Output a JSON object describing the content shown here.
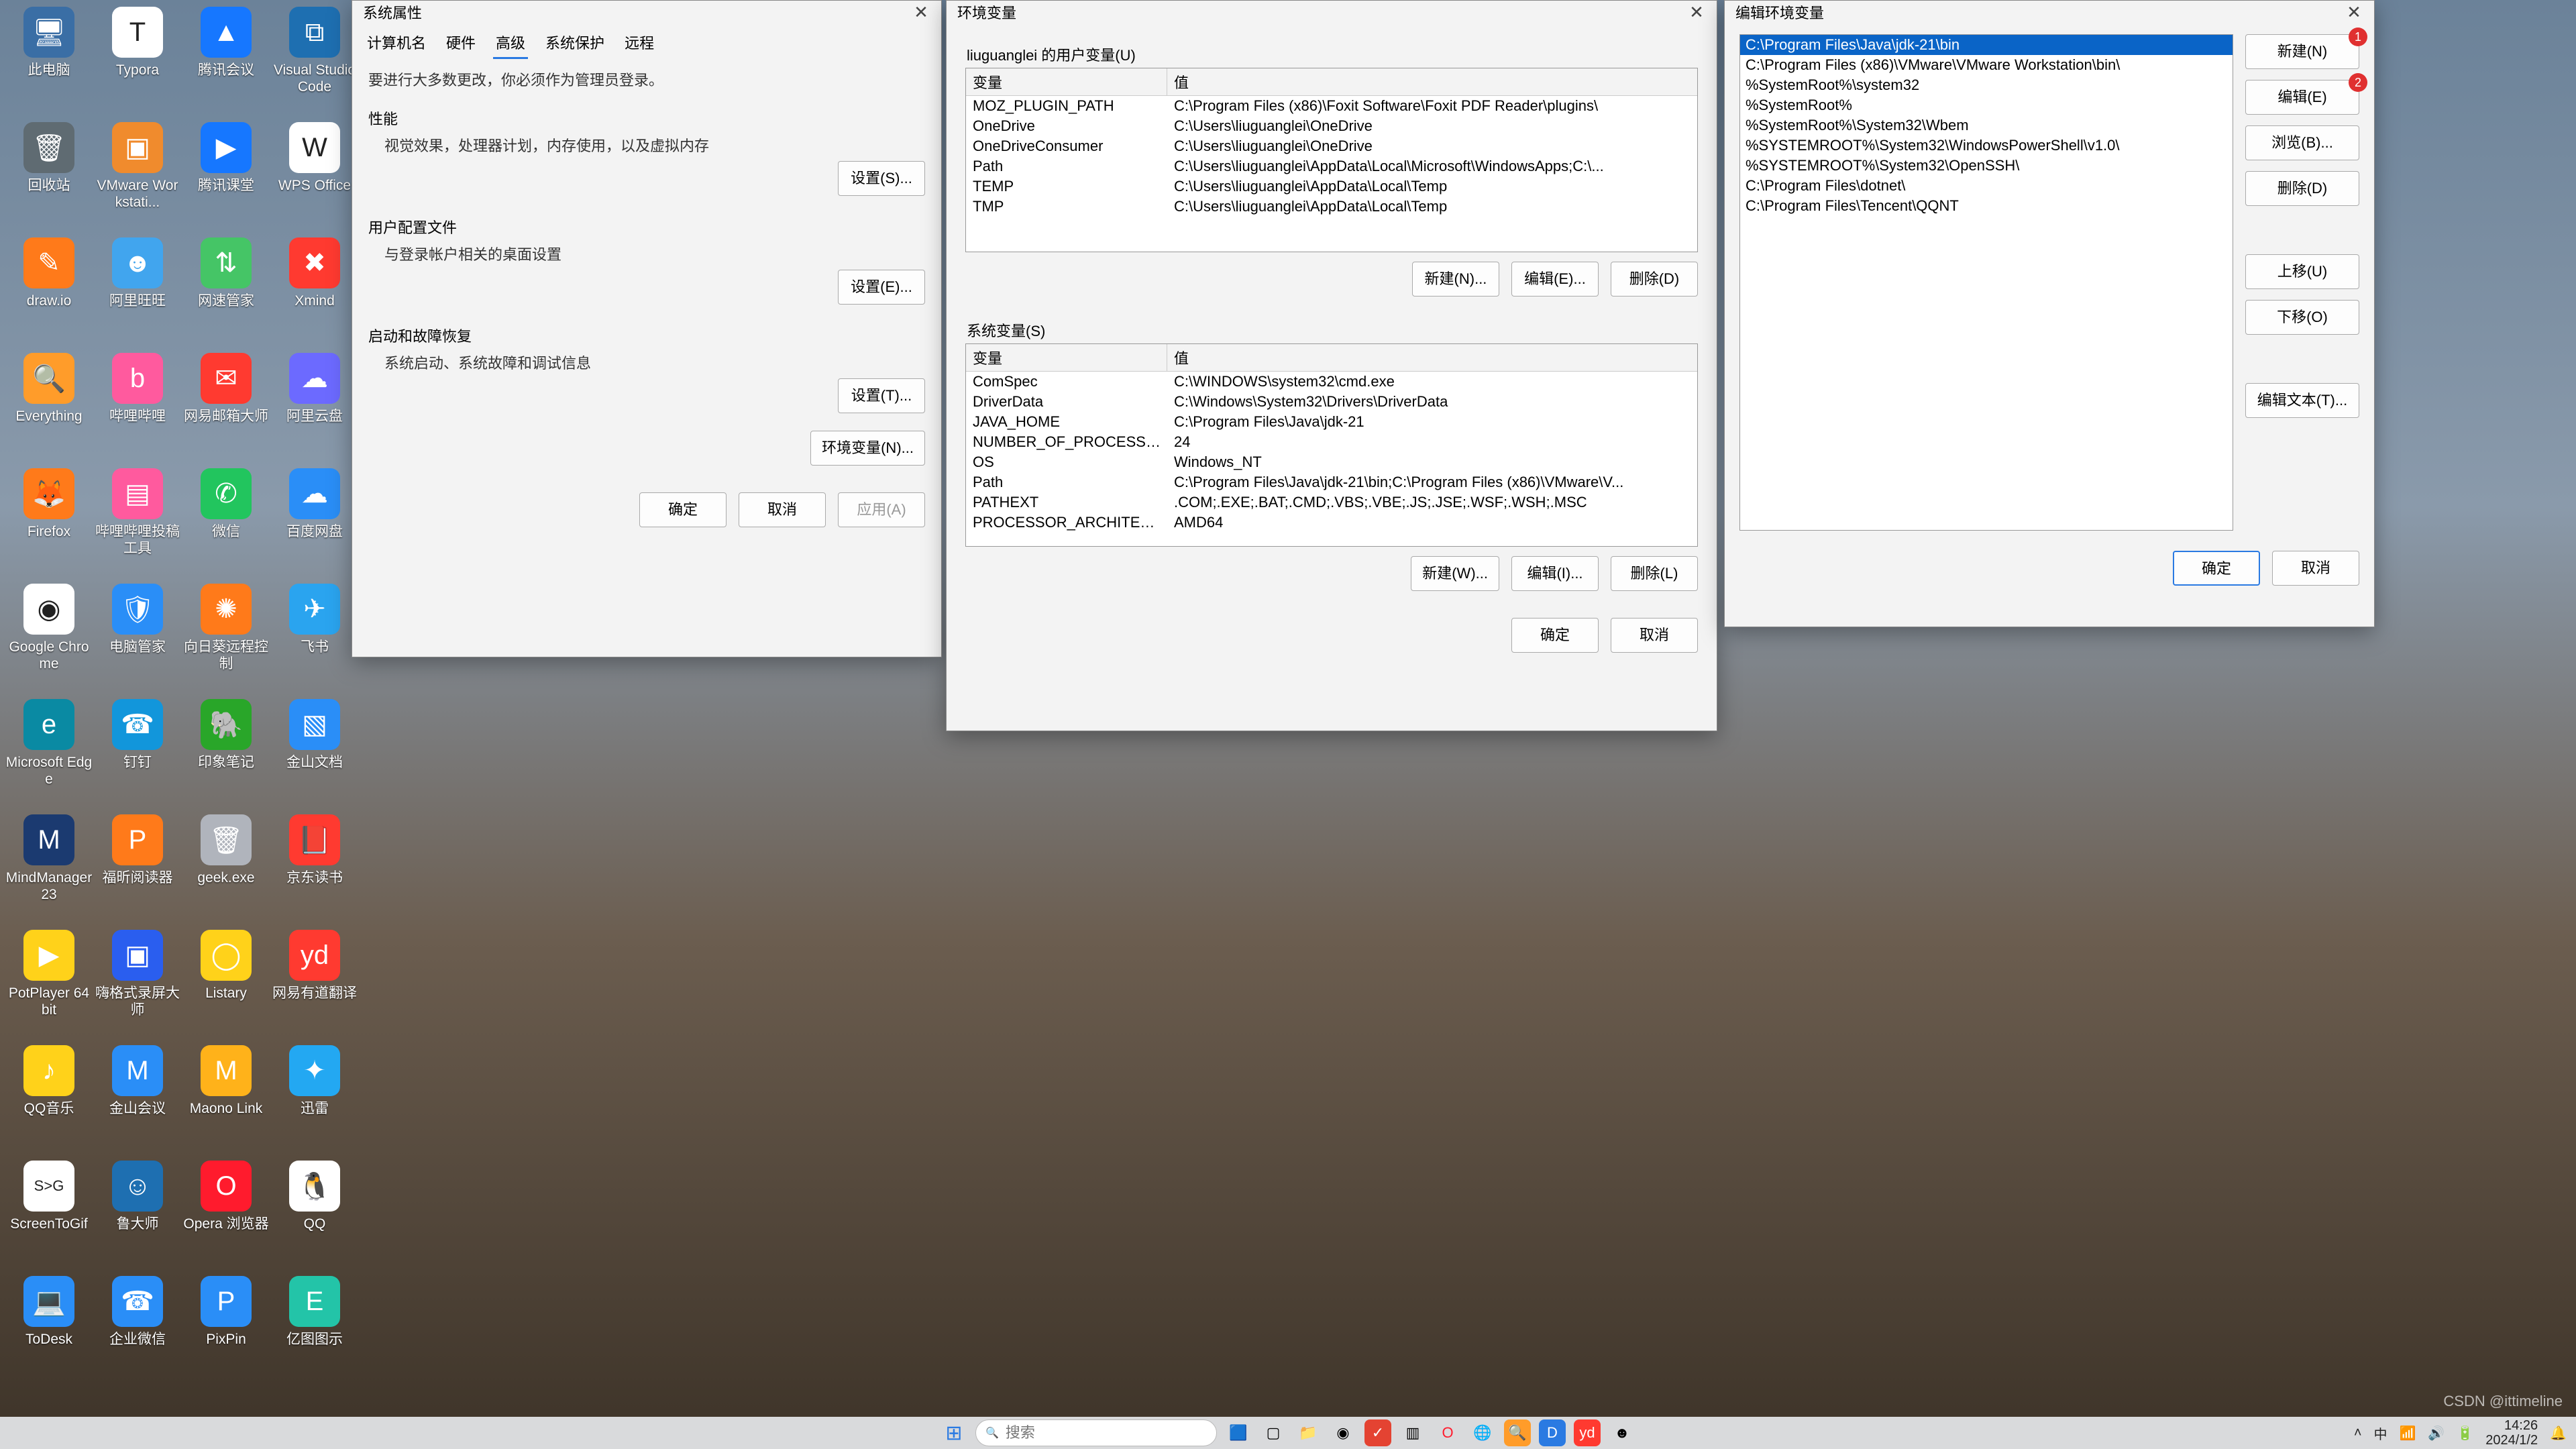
{
  "desktop_icons": [
    {
      "row": 0,
      "col": 0,
      "label": "此电脑",
      "bg": "#3a6ea5",
      "glyph": "🖥"
    },
    {
      "row": 0,
      "col": 1,
      "label": "Typora",
      "bg": "#ffffff",
      "glyph": "T"
    },
    {
      "row": 0,
      "col": 2,
      "label": "腾讯会议",
      "bg": "#1677ff",
      "glyph": "▲"
    },
    {
      "row": 0,
      "col": 3,
      "label": "Visual Studio Code",
      "bg": "#1e6fb1",
      "glyph": "⧉"
    },
    {
      "row": 1,
      "col": 0,
      "label": "回收站",
      "bg": "#5f6b72",
      "glyph": "🗑"
    },
    {
      "row": 1,
      "col": 1,
      "label": "VMware Workstati...",
      "bg": "#f08b2d",
      "glyph": "▣"
    },
    {
      "row": 1,
      "col": 2,
      "label": "腾讯课堂",
      "bg": "#1677ff",
      "glyph": "▶"
    },
    {
      "row": 1,
      "col": 3,
      "label": "WPS Office",
      "bg": "#ffffff",
      "glyph": "W"
    },
    {
      "row": 2,
      "col": 0,
      "label": "draw.io",
      "bg": "#ff7a1a",
      "glyph": "✎"
    },
    {
      "row": 2,
      "col": 1,
      "label": "阿里旺旺",
      "bg": "#41a5ee",
      "glyph": "☻"
    },
    {
      "row": 2,
      "col": 2,
      "label": "网速管家",
      "bg": "#45c566",
      "glyph": "⇅"
    },
    {
      "row": 2,
      "col": 3,
      "label": "Xmind",
      "bg": "#ff3a30",
      "glyph": "✖"
    },
    {
      "row": 3,
      "col": 0,
      "label": "Everything",
      "bg": "#ff9c2a",
      "glyph": "🔍"
    },
    {
      "row": 3,
      "col": 1,
      "label": "哔哩哔哩",
      "bg": "#ff5a9e",
      "glyph": "b"
    },
    {
      "row": 3,
      "col": 2,
      "label": "网易邮箱大师",
      "bg": "#ff3a30",
      "glyph": "✉"
    },
    {
      "row": 3,
      "col": 3,
      "label": "阿里云盘",
      "bg": "#6c6aff",
      "glyph": "☁"
    },
    {
      "row": 4,
      "col": 0,
      "label": "Firefox",
      "bg": "#ff7a1a",
      "glyph": "🦊"
    },
    {
      "row": 4,
      "col": 1,
      "label": "哔哩哔哩投稿工具",
      "bg": "#ff5a9e",
      "glyph": "▤"
    },
    {
      "row": 4,
      "col": 2,
      "label": "微信",
      "bg": "#22c55e",
      "glyph": "✆"
    },
    {
      "row": 4,
      "col": 3,
      "label": "百度网盘",
      "bg": "#2a8ef7",
      "glyph": "☁"
    },
    {
      "row": 5,
      "col": 0,
      "label": "Google Chrome",
      "bg": "#ffffff",
      "glyph": "◉"
    },
    {
      "row": 5,
      "col": 1,
      "label": "电脑管家",
      "bg": "#2a8ef7",
      "glyph": "🛡"
    },
    {
      "row": 5,
      "col": 2,
      "label": "向日葵远程控制",
      "bg": "#ff7a1a",
      "glyph": "✺"
    },
    {
      "row": 5,
      "col": 3,
      "label": "飞书",
      "bg": "#2aa4ef",
      "glyph": "✈"
    },
    {
      "row": 6,
      "col": 0,
      "label": "Microsoft Edge",
      "bg": "#0a8aa3",
      "glyph": "e"
    },
    {
      "row": 6,
      "col": 1,
      "label": "钉钉",
      "bg": "#1296db",
      "glyph": "☎"
    },
    {
      "row": 6,
      "col": 2,
      "label": "印象笔记",
      "bg": "#29a629",
      "glyph": "🐘"
    },
    {
      "row": 6,
      "col": 3,
      "label": "金山文档",
      "bg": "#2a8ef7",
      "glyph": "▧"
    },
    {
      "row": 7,
      "col": 0,
      "label": "MindManager 23",
      "bg": "#1b3a70",
      "glyph": "M"
    },
    {
      "row": 7,
      "col": 1,
      "label": "福昕阅读器",
      "bg": "#ff7a1a",
      "glyph": "P"
    },
    {
      "row": 7,
      "col": 2,
      "label": "geek.exe",
      "bg": "#b0b4bc",
      "glyph": "🗑"
    },
    {
      "row": 7,
      "col": 3,
      "label": "京东读书",
      "bg": "#ff3a30",
      "glyph": "📕"
    },
    {
      "row": 8,
      "col": 0,
      "label": "PotPlayer 64 bit",
      "bg": "#ffd21a",
      "glyph": "▶"
    },
    {
      "row": 8,
      "col": 1,
      "label": "嗨格式录屏大师",
      "bg": "#2a5eef",
      "glyph": "▣"
    },
    {
      "row": 8,
      "col": 2,
      "label": "Listary",
      "bg": "#ffd21a",
      "glyph": "◯"
    },
    {
      "row": 8,
      "col": 3,
      "label": "网易有道翻译",
      "bg": "#ff3a30",
      "glyph": "yd"
    },
    {
      "row": 9,
      "col": 0,
      "label": "QQ音乐",
      "bg": "#ffd21a",
      "glyph": "♪"
    },
    {
      "row": 9,
      "col": 1,
      "label": "金山会议",
      "bg": "#2a8ef7",
      "glyph": "M"
    },
    {
      "row": 9,
      "col": 2,
      "label": "Maono Link",
      "bg": "#ffb21a",
      "glyph": "M"
    },
    {
      "row": 9,
      "col": 3,
      "label": "迅雷",
      "bg": "#23a8f2",
      "glyph": "✦"
    },
    {
      "row": 10,
      "col": 0,
      "label": "ScreenToGif",
      "bg": "#ffffff",
      "glyph": "S>G"
    },
    {
      "row": 10,
      "col": 1,
      "label": "鲁大师",
      "bg": "#1e6fb1",
      "glyph": "☺"
    },
    {
      "row": 10,
      "col": 2,
      "label": "Opera 浏览器",
      "bg": "#ff1b2d",
      "glyph": "O"
    },
    {
      "row": 10,
      "col": 3,
      "label": "QQ",
      "bg": "#ffffff",
      "glyph": "🐧"
    },
    {
      "row": 11,
      "col": 0,
      "label": "ToDesk",
      "bg": "#2a8ef7",
      "glyph": "💻"
    },
    {
      "row": 11,
      "col": 1,
      "label": "企业微信",
      "bg": "#2a8ef7",
      "glyph": "☎"
    },
    {
      "row": 11,
      "col": 2,
      "label": "PixPin",
      "bg": "#2a8ef7",
      "glyph": "P"
    },
    {
      "row": 11,
      "col": 3,
      "label": "亿图图示",
      "bg": "#23c4a8",
      "glyph": "E"
    }
  ],
  "dlg_sysprops": {
    "title": "系统属性",
    "tabs": [
      "计算机名",
      "硬件",
      "高级",
      "系统保护",
      "远程"
    ],
    "active_tab_idx": 2,
    "note": "要进行大多数更改，你必须作为管理员登录。",
    "perf_h": "性能",
    "perf_p": "视觉效果，处理器计划，内存使用，以及虚拟内存",
    "perf_btn": "设置(S)...",
    "profile_h": "用户配置文件",
    "profile_p": "与登录帐户相关的桌面设置",
    "profile_btn": "设置(E)...",
    "startup_h": "启动和故障恢复",
    "startup_p": "系统启动、系统故障和调试信息",
    "startup_btn": "设置(T)...",
    "envbtn": "环境变量(N)...",
    "ok": "确定",
    "cancel": "取消",
    "apply": "应用(A)"
  },
  "dlg_envvars": {
    "title": "环境变量",
    "user_label": "liuguanglei 的用户变量(U)",
    "th_name": "变量",
    "th_val": "值",
    "user_vars": [
      {
        "n": "MOZ_PLUGIN_PATH",
        "v": "C:\\Program Files (x86)\\Foxit Software\\Foxit PDF Reader\\plugins\\"
      },
      {
        "n": "OneDrive",
        "v": "C:\\Users\\liuguanglei\\OneDrive"
      },
      {
        "n": "OneDriveConsumer",
        "v": "C:\\Users\\liuguanglei\\OneDrive"
      },
      {
        "n": "Path",
        "v": "C:\\Users\\liuguanglei\\AppData\\Local\\Microsoft\\WindowsApps;C:\\..."
      },
      {
        "n": "TEMP",
        "v": "C:\\Users\\liuguanglei\\AppData\\Local\\Temp"
      },
      {
        "n": "TMP",
        "v": "C:\\Users\\liuguanglei\\AppData\\Local\\Temp"
      }
    ],
    "user_new": "新建(N)...",
    "user_edit": "编辑(E)...",
    "user_del": "删除(D)",
    "sys_label": "系统变量(S)",
    "sys_vars": [
      {
        "n": "ComSpec",
        "v": "C:\\WINDOWS\\system32\\cmd.exe"
      },
      {
        "n": "DriverData",
        "v": "C:\\Windows\\System32\\Drivers\\DriverData"
      },
      {
        "n": "JAVA_HOME",
        "v": "C:\\Program Files\\Java\\jdk-21"
      },
      {
        "n": "NUMBER_OF_PROCESSORS",
        "v": "24"
      },
      {
        "n": "OS",
        "v": "Windows_NT"
      },
      {
        "n": "Path",
        "v": "C:\\Program Files\\Java\\jdk-21\\bin;C:\\Program Files (x86)\\VMware\\V..."
      },
      {
        "n": "PATHEXT",
        "v": ".COM;.EXE;.BAT;.CMD;.VBS;.VBE;.JS;.JSE;.WSF;.WSH;.MSC"
      },
      {
        "n": "PROCESSOR_ARCHITECTURE",
        "v": "AMD64"
      }
    ],
    "sys_new": "新建(W)...",
    "sys_edit": "编辑(I)...",
    "sys_del": "删除(L)",
    "ok": "确定",
    "cancel": "取消"
  },
  "dlg_editpath": {
    "title": "编辑环境变量",
    "paths": [
      "C:\\Program Files\\Java\\jdk-21\\bin",
      "C:\\Program Files (x86)\\VMware\\VMware Workstation\\bin\\",
      "%SystemRoot%\\system32",
      "%SystemRoot%",
      "%SystemRoot%\\System32\\Wbem",
      "%SYSTEMROOT%\\System32\\WindowsPowerShell\\v1.0\\",
      "%SYSTEMROOT%\\System32\\OpenSSH\\",
      "C:\\Program Files\\dotnet\\",
      "C:\\Program Files\\Tencent\\QQNT"
    ],
    "selected_idx": 0,
    "btn_new": "新建(N)",
    "btn_edit": "编辑(E)",
    "btn_browse": "浏览(B)...",
    "btn_del": "删除(D)",
    "btn_up": "上移(U)",
    "btn_down": "下移(O)",
    "btn_edittext": "编辑文本(T)...",
    "badge_new": "1",
    "badge_edit": "2",
    "ok": "确定",
    "cancel": "取消"
  },
  "taskbar": {
    "search_ph": "搜索",
    "time": "14:26",
    "date": "2024/1/2",
    "ime": "中",
    "tray_chevron": "˄"
  },
  "watermark": "CSDN @ittimeline"
}
